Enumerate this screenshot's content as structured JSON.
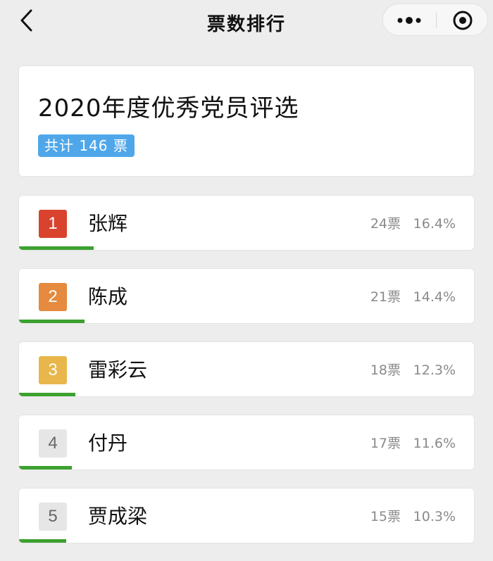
{
  "navbar": {
    "title": "票数排行",
    "back_icon": "chevron-left-icon",
    "more_icon": "more-dots-icon",
    "close_icon": "target-close-icon"
  },
  "poll": {
    "title": "2020年度优秀党员评选",
    "total_label": "共计 146 票"
  },
  "ranking": [
    {
      "rank": "1",
      "name": "张辉",
      "votes": "24票",
      "percent": "16.4%",
      "share": 0.164,
      "badge_color": "#d9432e",
      "badge_text_color": "#ffffff"
    },
    {
      "rank": "2",
      "name": "陈成",
      "votes": "21票",
      "percent": "14.4%",
      "share": 0.144,
      "badge_color": "#e58a3e",
      "badge_text_color": "#ffffff"
    },
    {
      "rank": "3",
      "name": "雷彩云",
      "votes": "18票",
      "percent": "12.3%",
      "share": 0.123,
      "badge_color": "#e8b64a",
      "badge_text_color": "#ffffff"
    },
    {
      "rank": "4",
      "name": "付丹",
      "votes": "17票",
      "percent": "11.6%",
      "share": 0.116,
      "badge_color": "#e6e6e6",
      "badge_text_color": "#666666"
    },
    {
      "rank": "5",
      "name": "贾成梁",
      "votes": "15票",
      "percent": "10.3%",
      "share": 0.103,
      "badge_color": "#e6e6e6",
      "badge_text_color": "#666666"
    }
  ],
  "colors": {
    "progress": "#3ba12f",
    "badge_blue": "#4fa7ea"
  }
}
